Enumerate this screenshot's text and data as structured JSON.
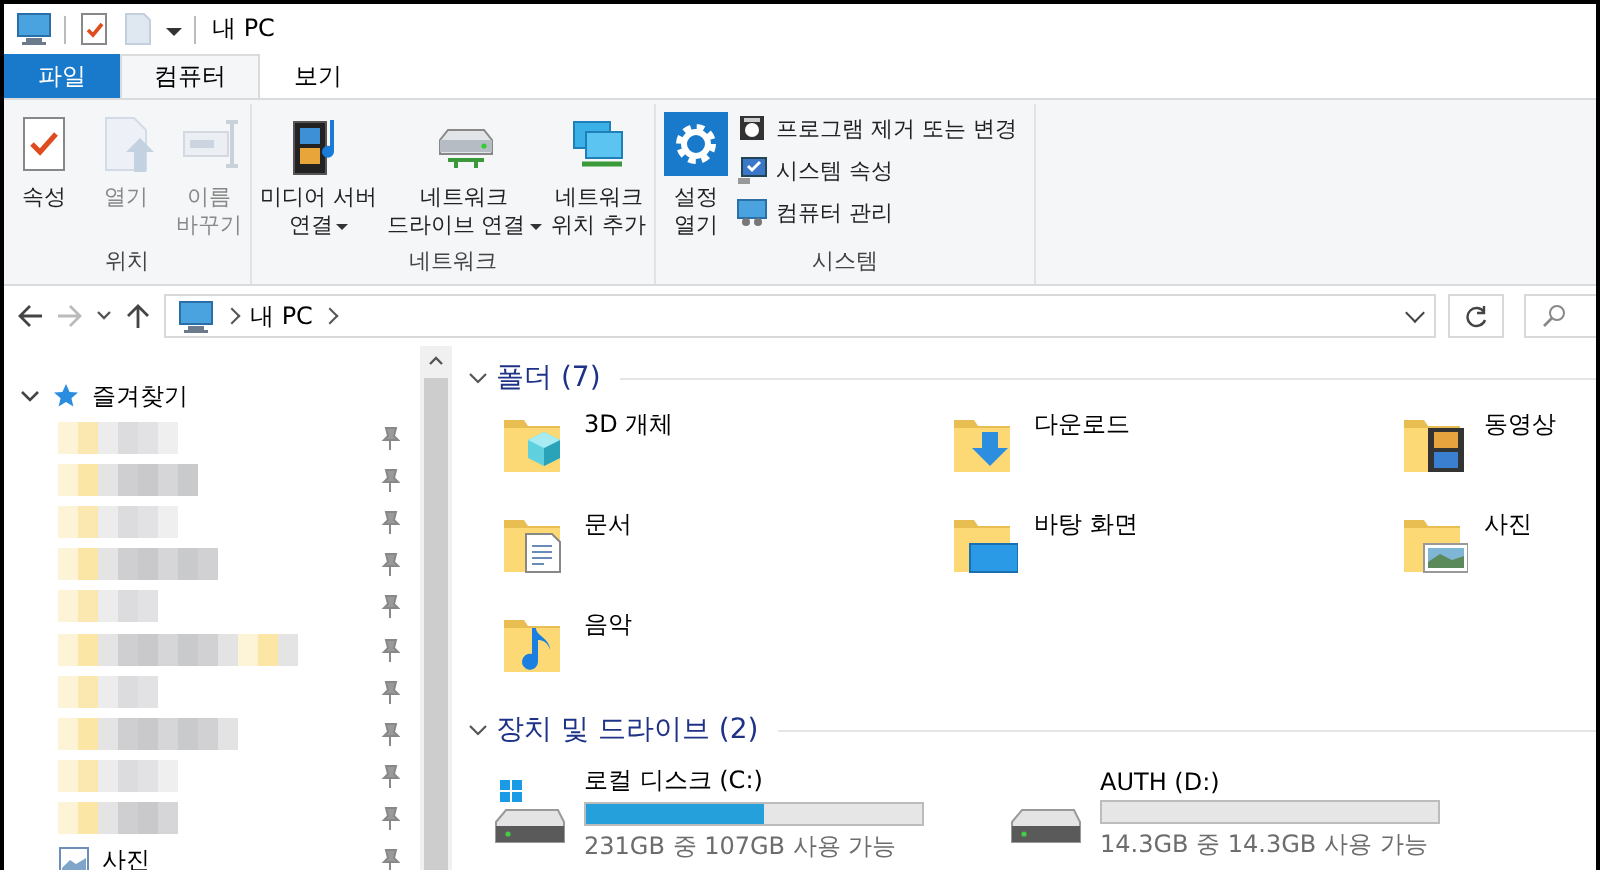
{
  "window": {
    "title": "내 PC"
  },
  "tabs": [
    {
      "label": "파일",
      "kind": "file",
      "selected": false
    },
    {
      "label": "컴퓨터",
      "kind": "tab",
      "selected": true
    },
    {
      "label": "보기",
      "kind": "tab",
      "selected": false
    }
  ],
  "ribbon": {
    "groups": [
      {
        "label": "위치",
        "buttons": [
          {
            "lines": [
              "속성"
            ],
            "disabled": false,
            "dropdown": false
          },
          {
            "lines": [
              "열기"
            ],
            "disabled": true,
            "dropdown": false
          },
          {
            "lines": [
              "이름",
              "바꾸기"
            ],
            "disabled": true,
            "dropdown": false
          }
        ]
      },
      {
        "label": "네트워크",
        "buttons": [
          {
            "lines": [
              "미디어 서버",
              "연결"
            ],
            "disabled": false,
            "dropdown": true
          },
          {
            "lines": [
              "네트워크",
              "드라이브 연결"
            ],
            "disabled": false,
            "dropdown": true
          },
          {
            "lines": [
              "네트워크",
              "위치 추가"
            ],
            "disabled": false,
            "dropdown": false
          }
        ]
      },
      {
        "label": "시스템",
        "buttons": [
          {
            "lines": [
              "설정",
              "열기"
            ],
            "disabled": false,
            "dropdown": false
          }
        ],
        "small_buttons": [
          {
            "label": "프로그램 제거 또는 변경"
          },
          {
            "label": "시스템 속성"
          },
          {
            "label": "컴퓨터 관리"
          }
        ]
      }
    ]
  },
  "address_bar": {
    "back_disabled": false,
    "forward_disabled": true,
    "path": [
      "내 PC"
    ]
  },
  "navigation_pane": {
    "quick_access": {
      "label": "즐겨찾기",
      "expanded": true,
      "items": [
        {
          "kind": "blurred",
          "pinned": true
        },
        {
          "kind": "blurred",
          "pinned": true
        },
        {
          "kind": "blurred",
          "pinned": true
        },
        {
          "kind": "blurred",
          "pinned": true
        },
        {
          "kind": "blurred",
          "pinned": true
        },
        {
          "kind": "blurred",
          "pinned": true
        },
        {
          "kind": "blurred",
          "pinned": true
        },
        {
          "kind": "blurred",
          "pinned": true
        },
        {
          "kind": "blurred",
          "pinned": true
        },
        {
          "kind": "blurred",
          "pinned": true
        },
        {
          "kind": "item",
          "label": "사진",
          "pinned": true
        }
      ]
    }
  },
  "content": {
    "folders": {
      "title": "폴더 (7)",
      "expanded": true,
      "items": [
        {
          "name": "3D 개체"
        },
        {
          "name": "다운로드"
        },
        {
          "name": "동영상"
        },
        {
          "name": "문서"
        },
        {
          "name": "바탕 화면"
        },
        {
          "name": "사진"
        },
        {
          "name": "음악"
        }
      ]
    },
    "drives": {
      "title": "장치 및 드라이브 (2)",
      "expanded": true,
      "items": [
        {
          "name": "로컬 디스크 (C:)",
          "system": true,
          "level": 0.53,
          "space": "231GB 중 107GB 사용 가능"
        },
        {
          "name": "AUTH (D:)",
          "system": false,
          "level": 0,
          "space": "14.3GB 중 14.3GB 사용 가능"
        }
      ]
    }
  }
}
